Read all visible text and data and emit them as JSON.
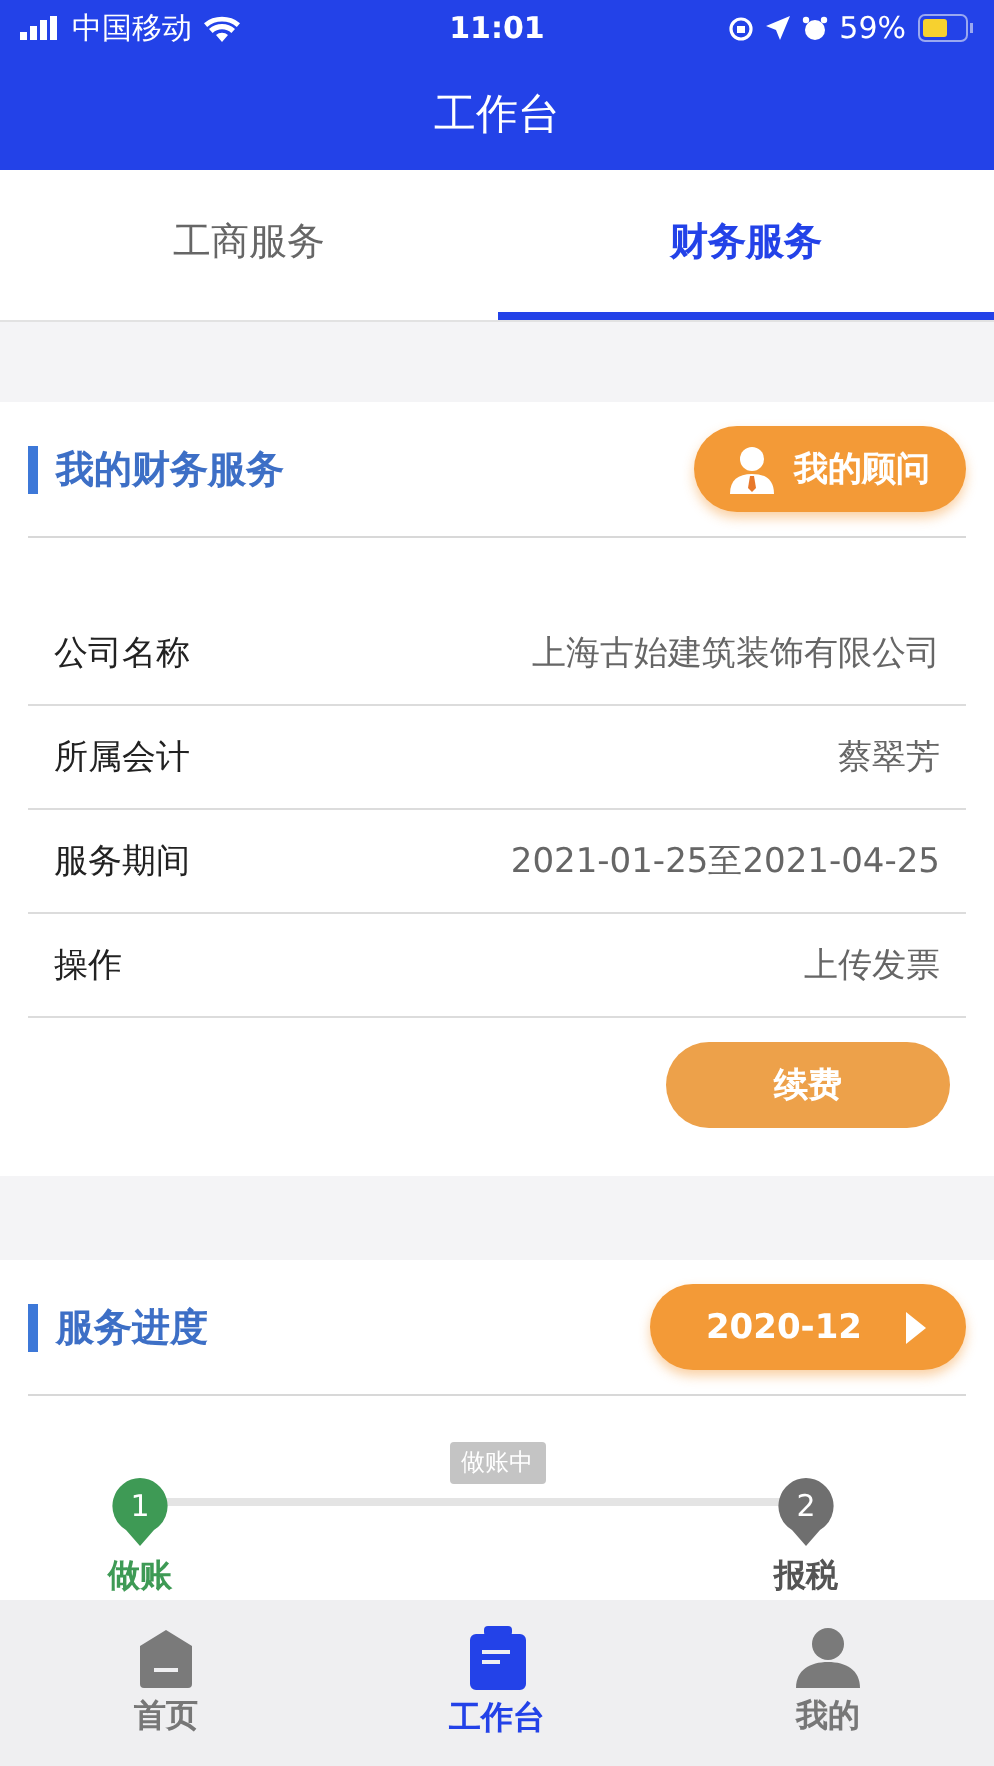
{
  "status_bar": {
    "carrier": "中国移动",
    "time": "11:01",
    "battery": "59%"
  },
  "header": {
    "title": "工作台"
  },
  "tabs": [
    {
      "label": "工商服务",
      "selected": false
    },
    {
      "label": "财务服务",
      "selected": true
    }
  ],
  "service_card": {
    "title": "我的财务服务",
    "advisor_button": "我的顾问",
    "rows": [
      {
        "label": "公司名称",
        "value": "上海古始建筑装饰有限公司"
      },
      {
        "label": "所属会计",
        "value": "蔡翠芳"
      },
      {
        "label": "服务期间",
        "value": "2021-01-25至2021-04-25"
      },
      {
        "label": "操作",
        "value": "上传发票"
      }
    ],
    "renew_button": "续费"
  },
  "progress_card": {
    "title": "服务进度",
    "period_button": "2020-12",
    "current_status": "做账中",
    "steps": [
      {
        "number": "1",
        "label": "做账",
        "done": true
      },
      {
        "number": "2",
        "label": "报税",
        "done": false
      }
    ]
  },
  "bottom_nav": [
    {
      "label": "首页",
      "kind": "home",
      "selected": false
    },
    {
      "label": "工作台",
      "kind": "workbench",
      "selected": true
    },
    {
      "label": "我的",
      "kind": "profile",
      "selected": false
    }
  ]
}
